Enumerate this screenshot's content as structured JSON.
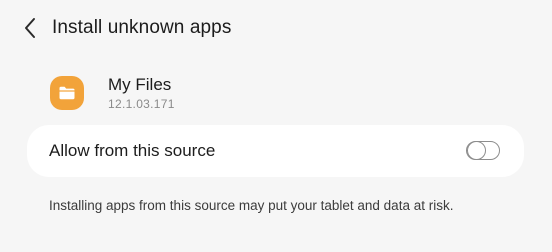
{
  "header": {
    "title": "Install unknown apps",
    "back_icon": "chevron-left-icon"
  },
  "app": {
    "name": "My Files",
    "version": "12.1.03.171",
    "icon": "folder-icon",
    "icon_color": "#f2a33a"
  },
  "setting": {
    "label": "Allow from this source",
    "toggle_on": false
  },
  "warning": "Installing apps from this source may put your tablet and data at risk."
}
